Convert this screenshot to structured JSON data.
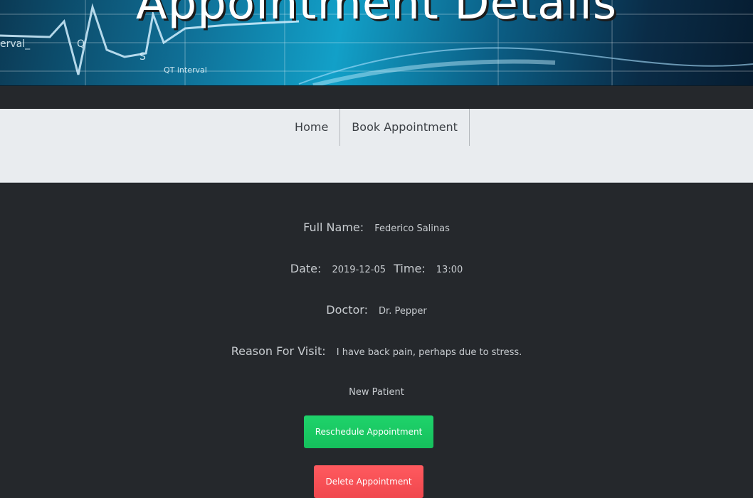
{
  "header": {
    "title": "Appointment Details"
  },
  "nav": {
    "items": [
      {
        "label": "Home"
      },
      {
        "label": "Book Appointment"
      }
    ]
  },
  "details": {
    "full_name_label": "Full Name:",
    "full_name_value": "Federico Salinas",
    "date_label": "Date:",
    "date_value": "2019-12-05",
    "time_label": "Time:",
    "time_value": "13:00",
    "doctor_label": "Doctor:",
    "doctor_value": "Dr. Pepper",
    "reason_label": "Reason For Visit:",
    "reason_value": "I have back pain, perhaps due to stress.",
    "patient_status": "New Patient"
  },
  "actions": {
    "reschedule_label": "Reschedule Appointment",
    "delete_label": "Delete Appointment"
  },
  "colors": {
    "background": "#25282c",
    "navbar": "#e9ecef",
    "reschedule": "#15c05c",
    "delete": "#f0474d"
  }
}
